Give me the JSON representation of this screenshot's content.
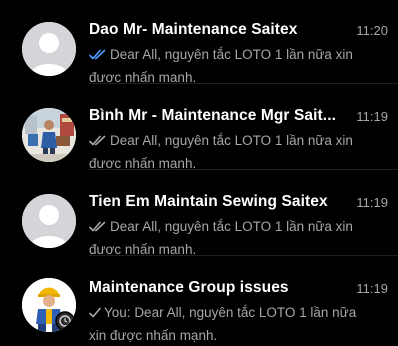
{
  "chats": [
    {
      "name": "Dao Mr- Maintenance Saitex",
      "time": "11:20",
      "preview": "Dear All, nguyên tắc  LOTO 1 lần nữa xin được nhấn mạnh.",
      "tick_icon": "double-check-icon",
      "tick_color": "#4a9eff",
      "avatar_icon": "default-person-icon"
    },
    {
      "name": "Bình Mr - Maintenance Mgr Sait...",
      "time": "11:19",
      "preview": "Dear All, nguyên tắc  LOTO 1 lần nữa xin được nhấn mạnh.",
      "tick_icon": "double-check-icon",
      "tick_color": "#a6a6ab",
      "avatar_icon": "photo-avatar"
    },
    {
      "name": "Tien Em Maintain Sewing Saitex",
      "time": "11:19",
      "preview": "Dear All, nguyên tắc  LOTO 1 lần nữa xin được nhấn mạnh.",
      "tick_icon": "double-check-icon",
      "tick_color": "#a6a6ab",
      "avatar_icon": "default-person-icon"
    },
    {
      "name": "Maintenance Group issues",
      "time": "11:19",
      "you_label": "You:",
      "preview": "Dear All, nguyên tắc  LOTO 1 lần nữa xin được nhấn mạnh.",
      "tick_icon": "single-check-icon",
      "tick_color": "#a6a6ab",
      "avatar_icon": "worker-avatar"
    }
  ]
}
